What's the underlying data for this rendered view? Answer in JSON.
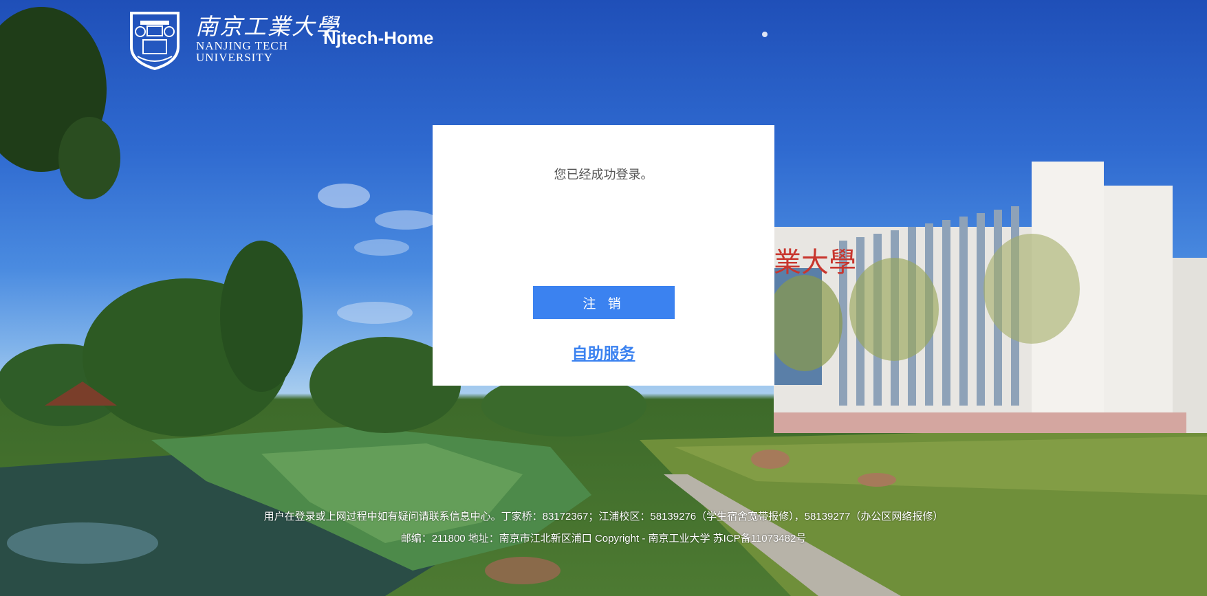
{
  "header": {
    "university_name_cn": "南京工業大學",
    "university_name_en_line1": "NANJING TECH",
    "university_name_en_line2": "UNIVERSITY",
    "site_title": "Njtech-Home"
  },
  "card": {
    "status_message": "您已经成功登录。",
    "logout_label": "注 销",
    "self_service_label": "自助服务"
  },
  "footer": {
    "line1": "用户在登录或上网过程中如有疑问请联系信息中心。丁家桥：83172367；江浦校区：58139276（学生宿舍宽带报修），58139277（办公区网络报修）",
    "line2": "邮编：211800  地址：南京市江北新区浦口 Copyright - 南京工业大学 苏ICP备11073482号"
  },
  "colors": {
    "button": "#3b82f0",
    "link": "#3b82f0",
    "card_bg": "#ffffff",
    "sky": "#2f6ad0"
  }
}
